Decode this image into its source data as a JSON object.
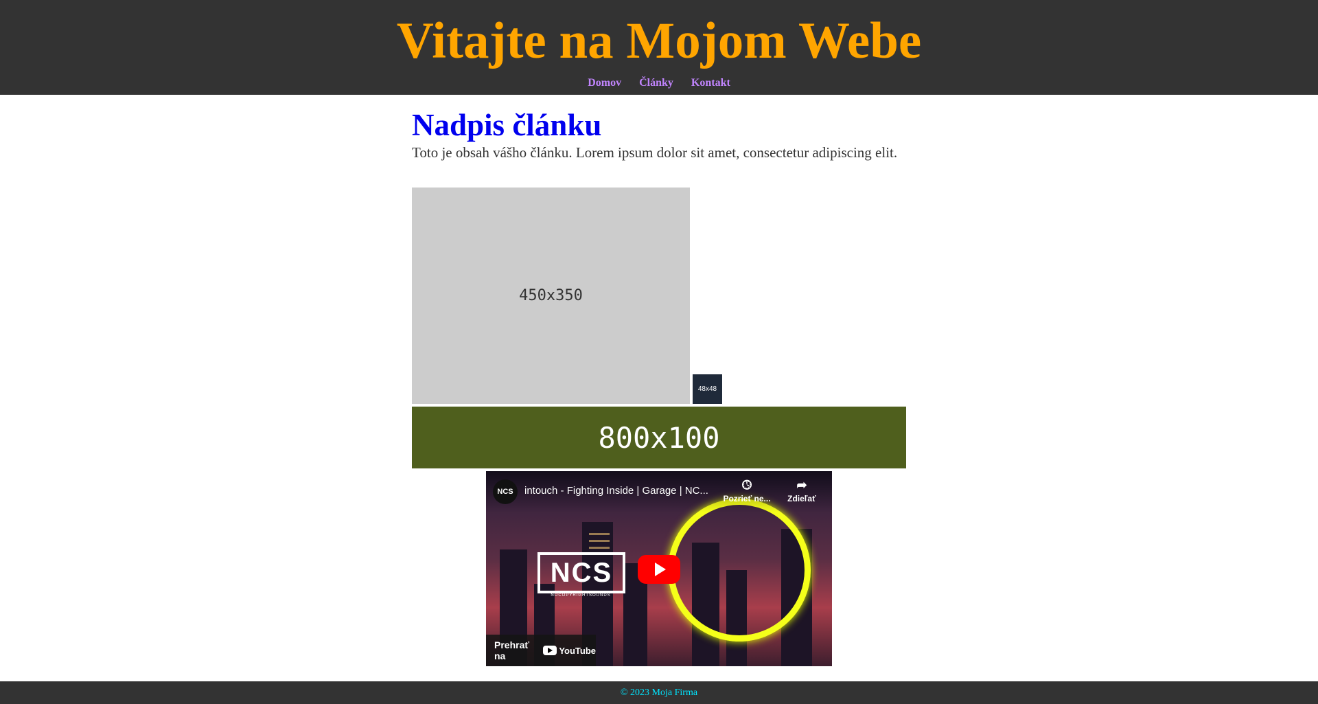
{
  "header": {
    "title": "Vitajte na Mojom Webe",
    "nav": [
      "Domov",
      "Články",
      "Kontakt"
    ]
  },
  "article": {
    "heading": "Nadpis článku",
    "body": "Toto je obsah vášho článku. Lorem ipsum dolor sit amet, consectetur adipiscing elit.",
    "image_large_label": "450x350",
    "image_small_label": "48x48",
    "banner_label": "800x100"
  },
  "video": {
    "channel_badge": "NCS",
    "title": "intouch - Fighting Inside | Garage | NC...",
    "watch_later_label": "Pozrieť ne...",
    "share_label": "Zdieľať",
    "logo_text": "NCS",
    "logo_subtext": "NOCOPYRIGHTSOUNDS",
    "watch_on_label": "Prehrať na",
    "youtube_label": "YouTube",
    "ring_color": "#f5ff1a"
  },
  "footer": {
    "text": "© 2023 Moja Firma"
  },
  "colors": {
    "header_bg": "#333333",
    "title": "#ffa500",
    "nav_link": "#c084fc",
    "heading": "#0000ee",
    "banner_bg": "#4f5f1d",
    "footer_text": "#00e5ff"
  }
}
